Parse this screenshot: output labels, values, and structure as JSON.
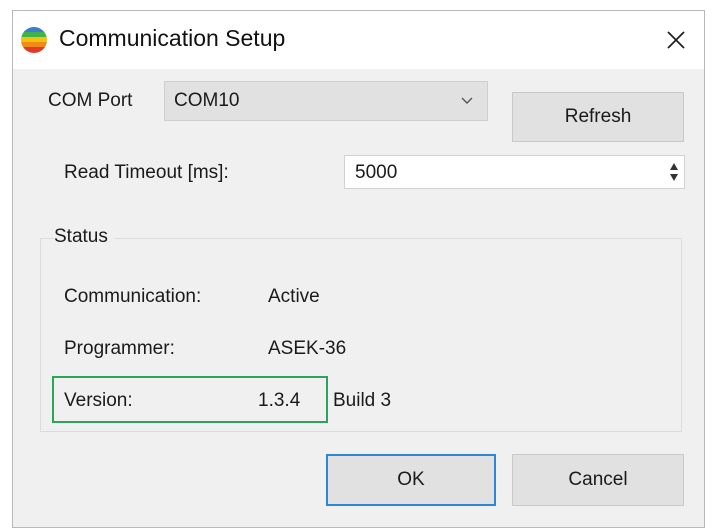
{
  "window": {
    "title": "Communication Setup",
    "icon": "app-globe-icon",
    "close_icon": "close-icon"
  },
  "com_port": {
    "label": "COM Port",
    "selected": "COM10",
    "refresh_label": "Refresh"
  },
  "timeout": {
    "label": "Read Timeout [ms]:",
    "value": "5000"
  },
  "status": {
    "group_label": "Status",
    "communication_label": "Communication:",
    "communication_value": "Active",
    "programmer_label": "Programmer:",
    "programmer_value": "ASEK-36",
    "version_label": "Version:",
    "version_value": "1.3.4",
    "build_value": "Build 3"
  },
  "buttons": {
    "ok_label": "OK",
    "cancel_label": "Cancel"
  },
  "colors": {
    "focus_border": "#2f86d6",
    "highlight_border": "#29a65a",
    "dialog_bg": "#f0f0f0"
  }
}
